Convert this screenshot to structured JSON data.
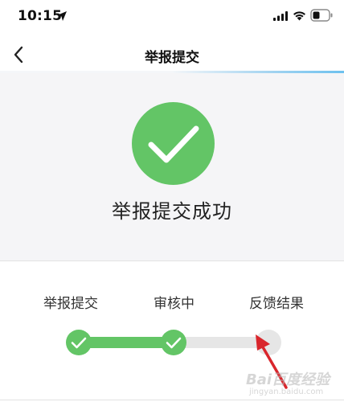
{
  "status_bar": {
    "time": "10:15",
    "icons": [
      "location-arrow-icon",
      "signal-icon",
      "wifi-icon",
      "battery-icon"
    ]
  },
  "nav": {
    "title": "举报提交",
    "back_icon": "chevron-left-icon"
  },
  "result": {
    "icon": "check-circle-icon",
    "message": "举报提交成功"
  },
  "progress": {
    "steps": [
      {
        "label": "举报提交",
        "state": "done"
      },
      {
        "label": "审核中",
        "state": "done"
      },
      {
        "label": "反馈结果",
        "state": "pending"
      }
    ]
  },
  "watermark": {
    "text": "Bai百度经验",
    "sub": "jingyan.baidu.com"
  },
  "colors": {
    "success_green": "#63c566",
    "track_gray": "#e6e6e6",
    "panel_bg": "#f5f5f7",
    "annotation_red": "#d9262c"
  }
}
